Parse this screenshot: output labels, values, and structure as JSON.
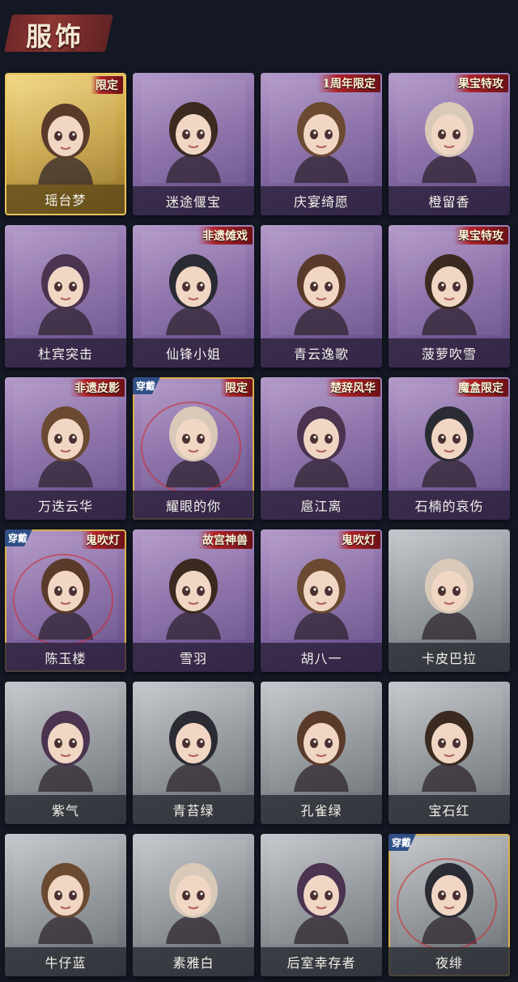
{
  "header": {
    "title": "服饰"
  },
  "colors": {
    "purple": "#8a6ea8",
    "gold": "#c9a54a",
    "gray": "#8f9499",
    "badge_red": "#b0232a",
    "wear_blue": "#2e4f86"
  },
  "items": [
    {
      "name": "瑶台梦",
      "tier": "gold",
      "badge": "限定",
      "worn": false
    },
    {
      "name": "迷途偃宝",
      "tier": "purple",
      "badge": "",
      "worn": false
    },
    {
      "name": "庆宴绮愿",
      "tier": "purple",
      "badge": "1周年限定",
      "worn": false
    },
    {
      "name": "橙留香",
      "tier": "purple",
      "badge": "果宝特攻",
      "worn": false
    },
    {
      "name": "杜宾突击",
      "tier": "purple",
      "badge": "",
      "worn": false
    },
    {
      "name": "仙锋小姐",
      "tier": "purple",
      "badge": "非遗傩戏",
      "worn": false
    },
    {
      "name": "青云逸歌",
      "tier": "purple",
      "badge": "",
      "worn": false
    },
    {
      "name": "菠萝吹雪",
      "tier": "purple",
      "badge": "果宝特攻",
      "worn": false
    },
    {
      "name": "万迭云华",
      "tier": "purple",
      "badge": "非遗皮影",
      "worn": false
    },
    {
      "name": "耀眼的你",
      "tier": "purple",
      "badge": "限定",
      "worn": true,
      "worn_label": "穿戴"
    },
    {
      "name": "扈江离",
      "tier": "purple",
      "badge": "楚辞风华",
      "worn": false
    },
    {
      "name": "石楠的哀伤",
      "tier": "purple",
      "badge": "魔盒限定",
      "worn": false
    },
    {
      "name": "陈玉楼",
      "tier": "purple",
      "badge": "鬼吹灯",
      "worn": true,
      "worn_label": "穿戴"
    },
    {
      "name": "雪羽",
      "tier": "purple",
      "badge": "故宫神兽",
      "worn": false
    },
    {
      "name": "胡八一",
      "tier": "purple",
      "badge": "鬼吹灯",
      "worn": false
    },
    {
      "name": "卡皮巴拉",
      "tier": "gray",
      "badge": "",
      "worn": false
    },
    {
      "name": "紫气",
      "tier": "gray",
      "badge": "",
      "worn": false
    },
    {
      "name": "青苔绿",
      "tier": "gray",
      "badge": "",
      "worn": false
    },
    {
      "name": "孔雀绿",
      "tier": "gray",
      "badge": "",
      "worn": false
    },
    {
      "name": "宝石红",
      "tier": "gray",
      "badge": "",
      "worn": false
    },
    {
      "name": "牛仔蓝",
      "tier": "gray",
      "badge": "",
      "worn": false
    },
    {
      "name": "素雅白",
      "tier": "gray",
      "badge": "",
      "worn": false
    },
    {
      "name": "后室幸存者",
      "tier": "gray",
      "badge": "",
      "worn": false
    },
    {
      "name": "夜绯",
      "tier": "gray",
      "badge": "",
      "worn": true,
      "worn_label": "穿戴"
    }
  ]
}
